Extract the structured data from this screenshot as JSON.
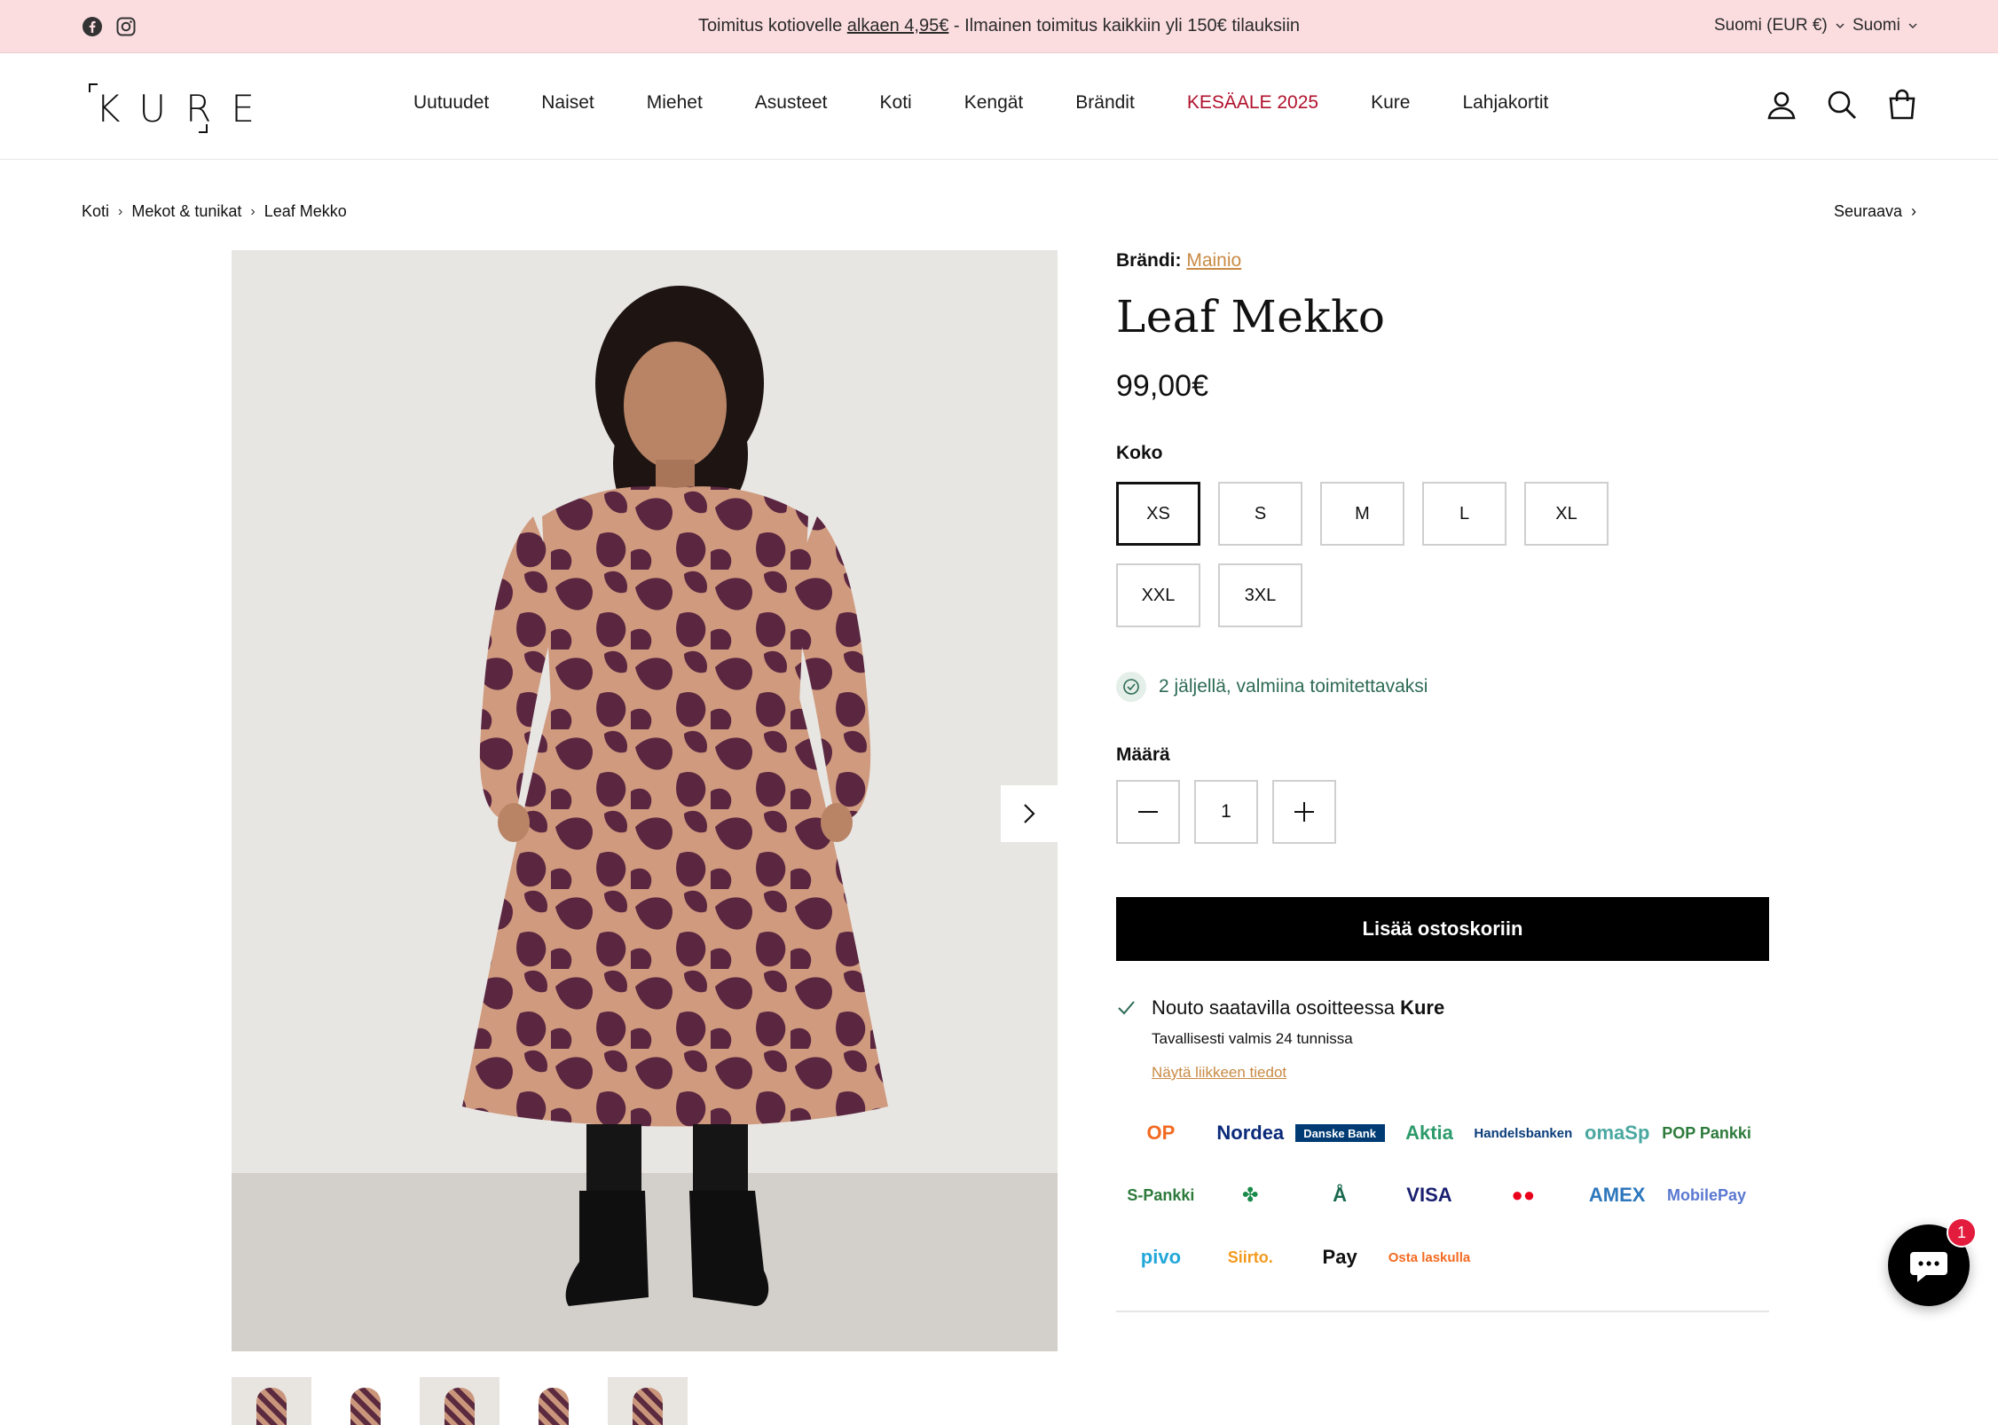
{
  "announcement": {
    "text_before": "Toimitus kotiovelle ",
    "text_link": "alkaen 4,95€",
    "text_after": " - Ilmainen toimitus kaikkiin yli 150€ tilauksiin",
    "currency_selector": "Suomi (EUR €)",
    "language_selector": "Suomi",
    "social_icons": [
      "facebook-icon",
      "instagram-icon"
    ]
  },
  "header": {
    "logo_text": "KURE",
    "nav": [
      "Uutuudet",
      "Naiset",
      "Miehet",
      "Asusteet",
      "Koti",
      "Kengät",
      "Brändit",
      "KESÄALE 2025",
      "Kure",
      "Lahjakortit"
    ],
    "highlight_color": "#b0122d",
    "icons": [
      "account-icon",
      "search-icon",
      "cart-icon"
    ]
  },
  "breadcrumb": {
    "items": [
      "Koti",
      "Mekot & tunikat",
      "Leaf Mekko"
    ],
    "next_label": "Seuraava"
  },
  "product": {
    "brand_label": "Brändi:",
    "brand_name": "Mainio",
    "title": "Leaf Mekko",
    "price": "99,00€",
    "size_label": "Koko",
    "sizes": [
      "XS",
      "S",
      "M",
      "L",
      "XL",
      "XXL",
      "3XL"
    ],
    "selected_size": "XS",
    "stock_text": "2 jäljellä, valmiina toimitettavaksi",
    "quantity_label": "Määrä",
    "quantity": "1",
    "add_to_cart": "Lisää ostoskoriin",
    "pickup_text": "Nouto saatavilla osoitteessa ",
    "pickup_store": "Kure",
    "pickup_time": "Tavallisesti valmis 24 tunnissa",
    "pickup_link": "Näytä liikkeen tiedot",
    "accent_color": "#c98a45",
    "stock_color": "#2d6b54"
  },
  "payment_logos": [
    {
      "name": "op-logo",
      "text": "OP",
      "color": "#f26a21"
    },
    {
      "name": "nordea-logo",
      "text": "Nordea",
      "color": "#0a2a7a"
    },
    {
      "name": "danske-bank-logo",
      "text": "Danske Bank",
      "color": "#003b73"
    },
    {
      "name": "aktia-logo",
      "text": "Aktia",
      "color": "#2d9b6b"
    },
    {
      "name": "handelsbanken-logo",
      "text": "Handelsbanken",
      "color": "#0a3d7a"
    },
    {
      "name": "omasp-logo",
      "text": "omaSp",
      "color": "#4aa8a0"
    },
    {
      "name": "pop-pankki-logo",
      "text": "POP Pankki",
      "color": "#2d7a3b"
    },
    {
      "name": "s-pankki-logo",
      "text": "S-Pankki",
      "color": "#2d7a3b"
    },
    {
      "name": "saastopankki-logo",
      "text": "✤",
      "color": "#1a8a4a"
    },
    {
      "name": "alandsbanken-logo",
      "text": "Å",
      "color": "#1a6a50"
    },
    {
      "name": "visa-logo",
      "text": "VISA",
      "color": "#1a1f71"
    },
    {
      "name": "mastercard-logo",
      "text": "●●",
      "color": "#eb001b"
    },
    {
      "name": "amex-logo",
      "text": "AMEX",
      "color": "#2e77bc"
    },
    {
      "name": "mobilepay-logo",
      "text": "MobilePay",
      "color": "#5a78d0"
    },
    {
      "name": "pivo-logo",
      "text": "pivo",
      "color": "#23a7d9"
    },
    {
      "name": "siirto-logo",
      "text": "Siirto.",
      "color": "#f39a1e"
    },
    {
      "name": "apple-pay-logo",
      "text": "Pay",
      "color": "#111111"
    },
    {
      "name": "osta-laskulla-logo",
      "text": "Osta laskulla",
      "color": "#f26a21"
    }
  ],
  "chat": {
    "badge": "1"
  }
}
